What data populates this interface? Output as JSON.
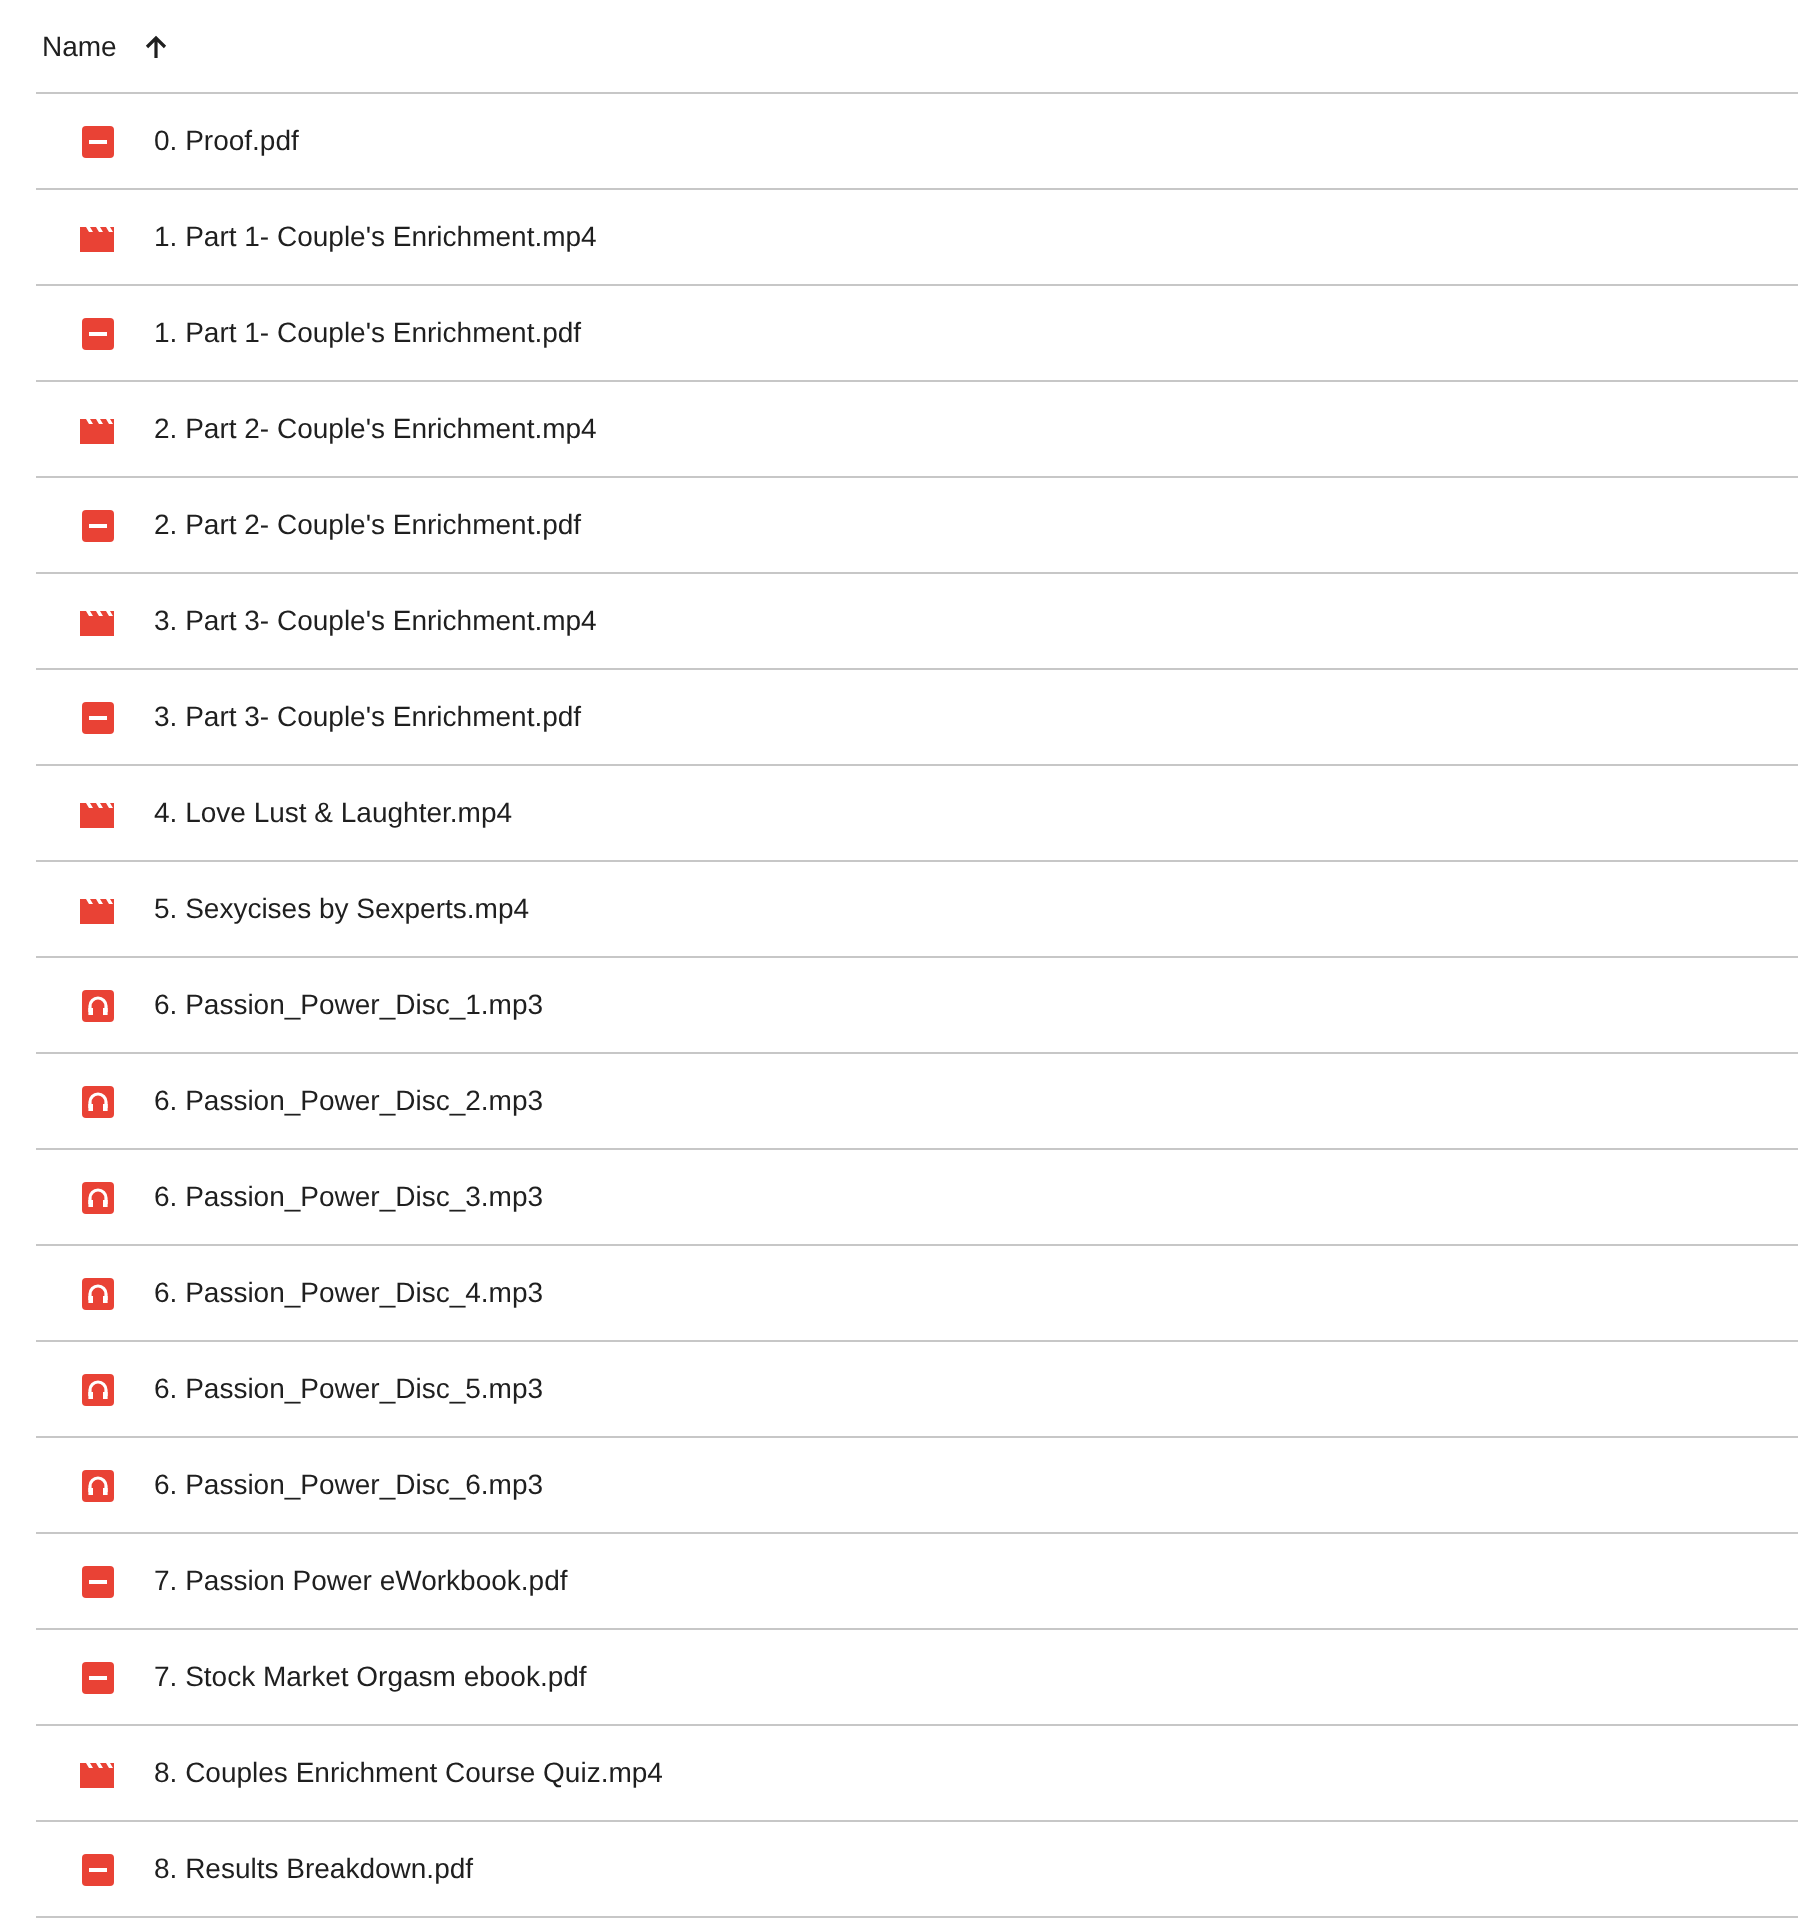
{
  "header": {
    "label": "Name"
  },
  "files": [
    {
      "name": "0. Proof.pdf",
      "kind": "pdf"
    },
    {
      "name": "1. Part 1- Couple's Enrichment.mp4",
      "kind": "video"
    },
    {
      "name": "1. Part 1- Couple's Enrichment.pdf",
      "kind": "pdf"
    },
    {
      "name": "2. Part 2- Couple's Enrichment.mp4",
      "kind": "video"
    },
    {
      "name": "2. Part 2- Couple's Enrichment.pdf",
      "kind": "pdf"
    },
    {
      "name": "3. Part 3- Couple's Enrichment.mp4",
      "kind": "video"
    },
    {
      "name": "3. Part 3- Couple's Enrichment.pdf",
      "kind": "pdf"
    },
    {
      "name": "4. Love Lust & Laughter.mp4",
      "kind": "video"
    },
    {
      "name": "5. Sexycises by Sexperts.mp4",
      "kind": "video"
    },
    {
      "name": "6. Passion_Power_Disc_1.mp3",
      "kind": "audio"
    },
    {
      "name": "6. Passion_Power_Disc_2.mp3",
      "kind": "audio"
    },
    {
      "name": "6. Passion_Power_Disc_3.mp3",
      "kind": "audio"
    },
    {
      "name": "6. Passion_Power_Disc_4.mp3",
      "kind": "audio"
    },
    {
      "name": "6. Passion_Power_Disc_5.mp3",
      "kind": "audio"
    },
    {
      "name": "6. Passion_Power_Disc_6.mp3",
      "kind": "audio"
    },
    {
      "name": "7. Passion Power eWorkbook.pdf",
      "kind": "pdf"
    },
    {
      "name": "7. Stock Market Orgasm ebook.pdf",
      "kind": "pdf"
    },
    {
      "name": "8. Couples Enrichment Course Quiz.mp4",
      "kind": "video"
    },
    {
      "name": "8. Results Breakdown.pdf",
      "kind": "pdf"
    }
  ]
}
